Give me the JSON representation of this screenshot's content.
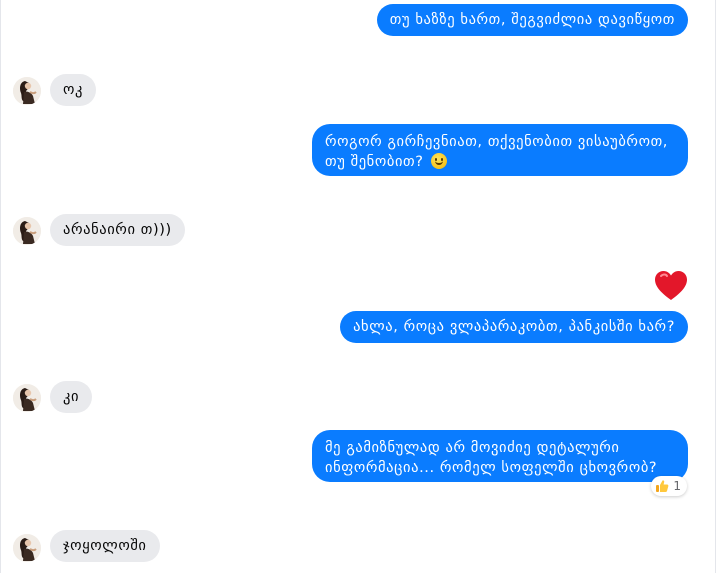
{
  "messages": [
    {
      "dir": "out",
      "text": "თუ ხაზზე ხართ, შეგვიძლია დავიწყოთ"
    },
    {
      "dir": "in",
      "text": "ოკ"
    },
    {
      "dir": "out",
      "text": "როგორ გირჩევნიათ, თქვენობით ვისაუბროთ, თუ შენობით?"
    },
    {
      "dir": "in",
      "text": "არანაირი თ)))"
    },
    {
      "dir": "out",
      "text": "ახლა, როცა ვლაპარაკობთ, პანკისში ხარ?"
    },
    {
      "dir": "in",
      "text": "კი"
    },
    {
      "dir": "out",
      "text": "მე გამიზნულად არ მოვიძიე დეტალური ინფორმაცია... რომელ სოფელში ცხოვრობ?"
    },
    {
      "dir": "in",
      "text": "ჯოყოლოში"
    }
  ],
  "reactions": {
    "heart_icon": "heart-emoji",
    "like_icon": "thumbs-up-emoji",
    "like_count": "1"
  },
  "colors": {
    "outgoing_bubble": "#0a7cff",
    "incoming_bubble": "#e9eaed"
  }
}
